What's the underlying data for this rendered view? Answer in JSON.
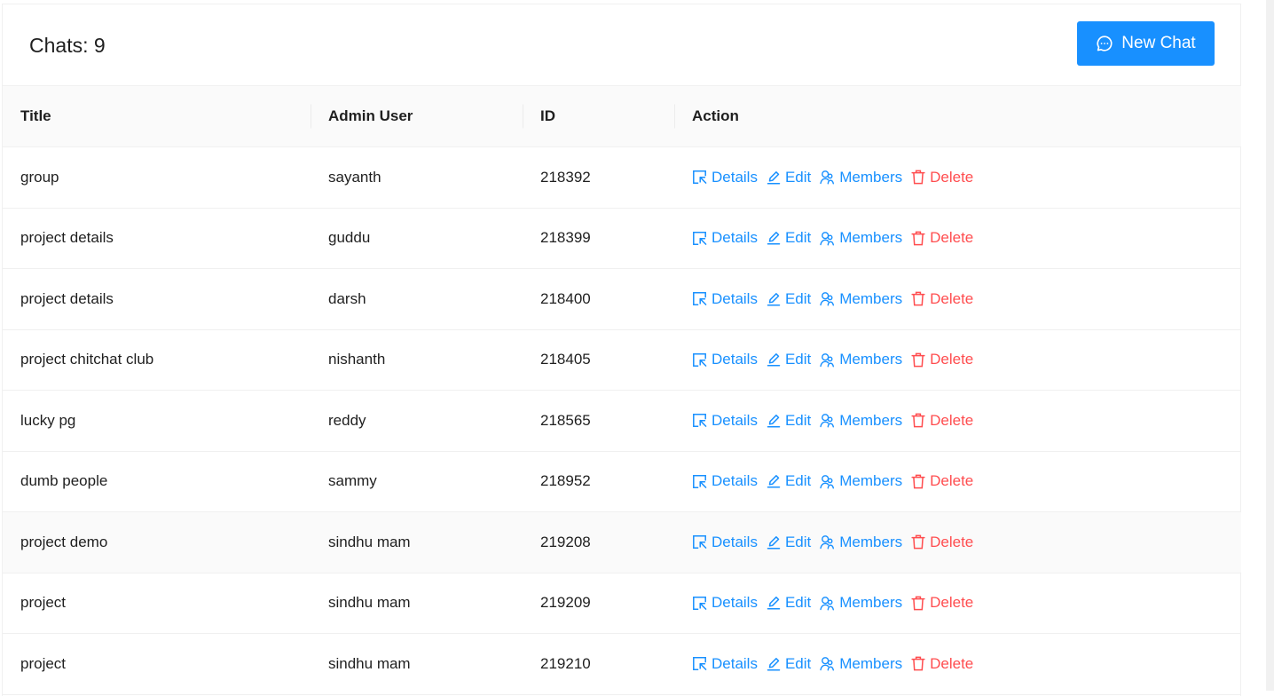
{
  "header": {
    "title": "Chats: 9",
    "new_chat_label": "New Chat"
  },
  "table": {
    "columns": [
      "Title",
      "Admin User",
      "ID",
      "Action"
    ],
    "action_labels": {
      "details": "Details",
      "edit": "Edit",
      "members": "Members",
      "delete": "Delete"
    },
    "rows": [
      {
        "title": "group",
        "admin": "sayanth",
        "id": "218392"
      },
      {
        "title": "project details",
        "admin": "guddu",
        "id": "218399"
      },
      {
        "title": "project details",
        "admin": "darsh",
        "id": "218400"
      },
      {
        "title": "project chitchat club",
        "admin": "nishanth",
        "id": "218405"
      },
      {
        "title": "lucky pg",
        "admin": "reddy",
        "id": "218565"
      },
      {
        "title": "dumb people",
        "admin": "sammy",
        "id": "218952"
      },
      {
        "title": "project demo",
        "admin": "sindhu mam",
        "id": "219208"
      },
      {
        "title": "project",
        "admin": "sindhu mam",
        "id": "219209"
      },
      {
        "title": "project",
        "admin": "sindhu mam",
        "id": "219210"
      }
    ]
  },
  "colors": {
    "primary": "#1890ff",
    "danger": "#ff4d4f",
    "header_bg": "#fafafa"
  },
  "icons": {
    "new_chat": "message-icon",
    "details": "select-icon",
    "edit": "edit-icon",
    "members": "usergroup-icon",
    "delete": "delete-icon"
  }
}
